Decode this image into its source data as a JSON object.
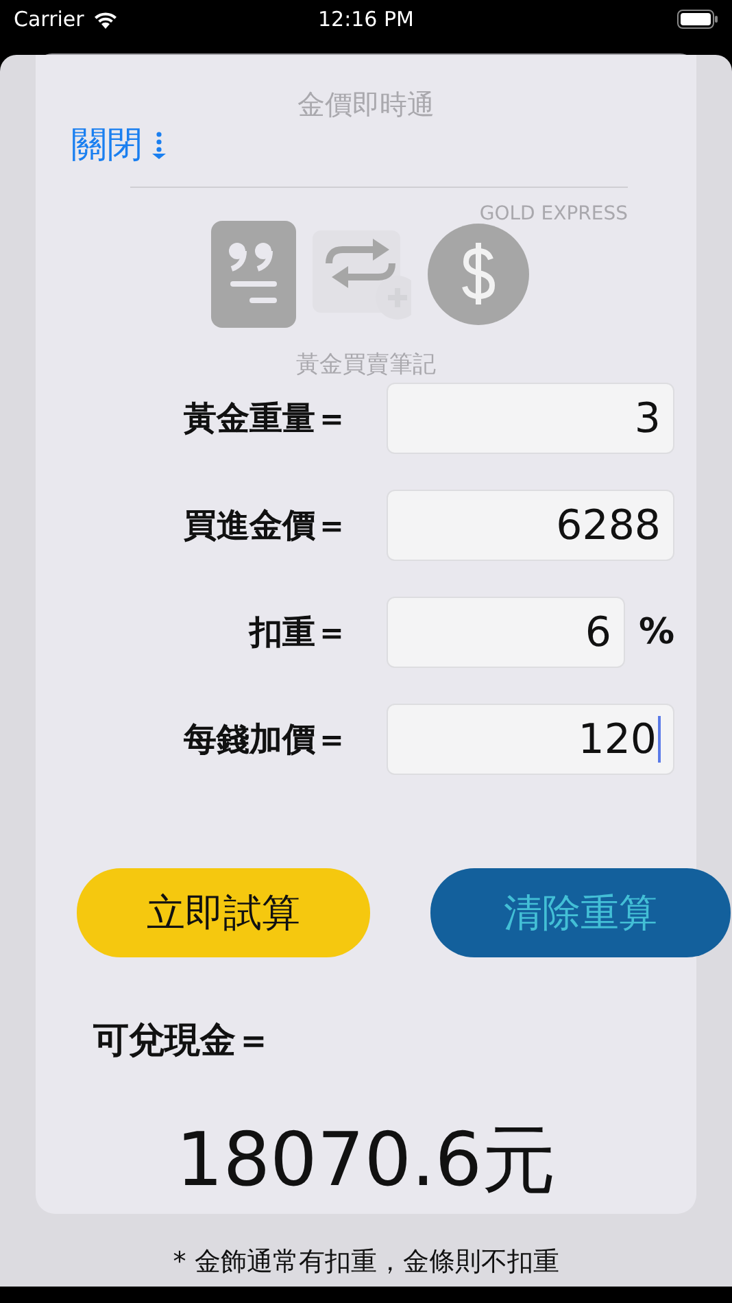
{
  "status_bar": {
    "carrier": "Carrier",
    "time": "12:16 PM"
  },
  "background": {
    "title": "金價即時通",
    "subtitle": "GOLD EXPRESS",
    "caption": "黃金買賣筆記"
  },
  "close_label": "關閉",
  "fields": [
    {
      "label": "黃金重量＝",
      "value": "3",
      "focused": false
    },
    {
      "label": "買進金價＝",
      "value": "6288",
      "focused": false
    },
    {
      "label": "扣重＝",
      "value": "6",
      "unit": "%",
      "focused": false
    },
    {
      "label": "每錢加價＝",
      "value": "120",
      "focused": true
    }
  ],
  "buttons": [
    {
      "label": "立即試算",
      "kind": "primary"
    },
    {
      "label": "清除重算",
      "kind": "secondary"
    }
  ],
  "result": {
    "label": "可兌現金＝",
    "value": "18070.6元"
  },
  "footnote": "* 金飾通常有扣重，金條則不扣重"
}
